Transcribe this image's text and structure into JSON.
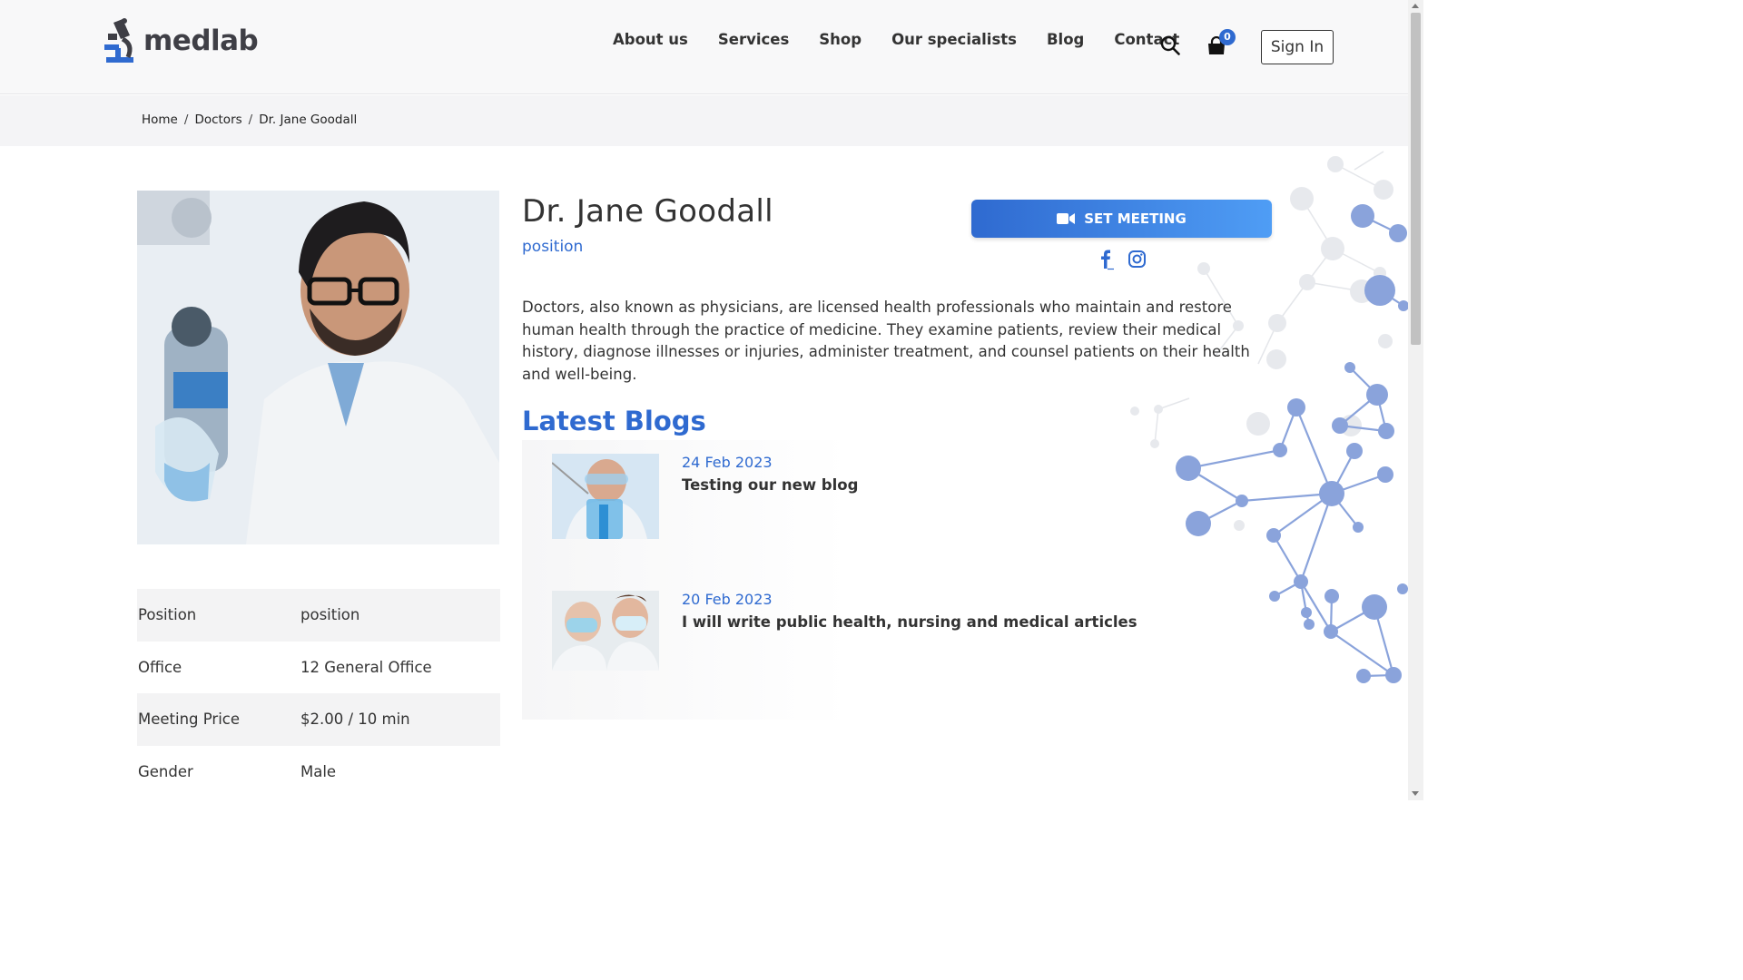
{
  "header": {
    "logo_text": "medlab",
    "nav": [
      "About us",
      "Services",
      "Shop",
      "Our specialists",
      "Blog",
      "Contact"
    ],
    "cart_count": "0",
    "signin_label": "Sign In"
  },
  "breadcrumb": [
    "Home",
    "Doctors",
    "Dr. Jane Goodall"
  ],
  "doctor": {
    "name": "Dr. Jane Goodall",
    "position": "position",
    "bio": "Doctors, also known as physicians, are licensed health professionals who maintain and restore human health through the practice of medicine. They examine patients, review their medical history, diagnose illnesses or injuries, administer treatment, and counsel patients on their health and well-being.",
    "set_meeting_label": "SET MEETING",
    "info": [
      {
        "label": "Position",
        "value": "position"
      },
      {
        "label": "Office",
        "value": "12 General Office"
      },
      {
        "label": "Meeting Price",
        "value": "$2.00 / 10 min"
      },
      {
        "label": "Gender",
        "value": "Male"
      }
    ]
  },
  "blogs": {
    "heading": "Latest Blogs",
    "items": [
      {
        "date": "24 Feb 2023",
        "title": "Testing our new blog"
      },
      {
        "date": "20 Feb 2023",
        "title": "I will write public health, nursing and medical articles"
      }
    ]
  },
  "colors": {
    "accent": "#2f6ad0",
    "text": "#333333",
    "header_bg": "#f8f8f9"
  },
  "icons": [
    "microscope-logo-icon",
    "search-icon",
    "cart-icon",
    "video-camera-icon",
    "facebook-icon",
    "instagram-icon"
  ]
}
